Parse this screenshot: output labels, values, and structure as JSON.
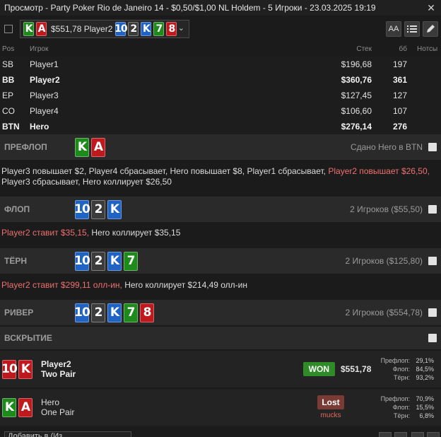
{
  "window": {
    "title": "Просмотр - Party Poker Rio de Janeiro 14 - $0,50/$1,00 NL Holdem - 5 Игроки - 23.03.2025 19:19",
    "close_glyph": "✕"
  },
  "hand_selector": {
    "hero_cards": [
      {
        "rank": "K",
        "suit": "c"
      },
      {
        "rank": "A",
        "suit": "h"
      }
    ],
    "amount": "$551,78 Player2",
    "board": [
      {
        "rank": "10",
        "suit": "d"
      },
      {
        "rank": "2",
        "suit": "s"
      },
      {
        "rank": "K",
        "suit": "d"
      },
      {
        "rank": "7",
        "suit": "c"
      },
      {
        "rank": "8",
        "suit": "h"
      }
    ],
    "caret": "⌄"
  },
  "toolbar_icons": {
    "font_size": "AA",
    "list": "list-icon",
    "edit": "pencil-icon"
  },
  "players": {
    "headers": {
      "pos": "Pos",
      "name": "Игрок",
      "stack": "Стек",
      "bb": "бб",
      "notes": "Нотсы"
    },
    "rows": [
      {
        "pos": "SB",
        "name": "Player1",
        "stack": "$196,68",
        "bb": "197",
        "bold": false
      },
      {
        "pos": "BB",
        "name": "Player2",
        "stack": "$360,76",
        "bb": "361",
        "bold": true
      },
      {
        "pos": "EP",
        "name": "Player3",
        "stack": "$127,45",
        "bb": "127",
        "bold": false
      },
      {
        "pos": "CO",
        "name": "Player4",
        "stack": "$106,60",
        "bb": "107",
        "bold": false
      },
      {
        "pos": "BTN",
        "name": "Hero",
        "stack": "$276,14",
        "bb": "276",
        "bold": true
      }
    ]
  },
  "streets": {
    "preflop": {
      "name": "ПРЕФЛОП",
      "info": "Сдано Hero в BTN",
      "cards": [
        {
          "rank": "K",
          "suit": "c"
        },
        {
          "rank": "A",
          "suit": "h"
        }
      ],
      "actions": [
        {
          "text": "Player3 повышает $2, Player4 сбрасывает, Hero повышает $8, Player1 сбрасывает, ",
          "red": false
        },
        {
          "text": "Player2 повышает $26,50,",
          "red": true
        },
        {
          "text": " Player3 сбрасывает, Hero коллирует $26,50",
          "red": false
        }
      ]
    },
    "flop": {
      "name": "ФЛОП",
      "info": "2 Игроков ($55,50)",
      "cards": [
        {
          "rank": "10",
          "suit": "d"
        },
        {
          "rank": "2",
          "suit": "s"
        },
        {
          "rank": "K",
          "suit": "d"
        }
      ],
      "actions": [
        {
          "text": "Player2 ставит $35,15,",
          "red": true
        },
        {
          "text": " Hero коллирует $35,15",
          "red": false
        }
      ]
    },
    "turn": {
      "name": "ТЁРН",
      "info": "2 Игроков ($125,80)",
      "cards": [
        {
          "rank": "10",
          "suit": "d"
        },
        {
          "rank": "2",
          "suit": "s"
        },
        {
          "rank": "K",
          "suit": "d"
        },
        {
          "rank": "7",
          "suit": "c"
        }
      ],
      "actions": [
        {
          "text": "Player2 ставит $299,11 олл-ин,",
          "red": true
        },
        {
          "text": " Hero коллирует $214,49 олл-ин",
          "red": false
        }
      ]
    },
    "river": {
      "name": "РИВЕР",
      "info": "2 Игроков ($554,78)",
      "cards": [
        {
          "rank": "10",
          "suit": "d"
        },
        {
          "rank": "2",
          "suit": "s"
        },
        {
          "rank": "K",
          "suit": "d"
        },
        {
          "rank": "7",
          "suit": "c"
        },
        {
          "rank": "8",
          "suit": "h"
        }
      ]
    },
    "showdown": {
      "name": "ВСКРЫТИЕ"
    }
  },
  "showdown": [
    {
      "player": "Player2",
      "hand": "Two Pair",
      "cards": [
        {
          "rank": "10",
          "suit": "h"
        },
        {
          "rank": "K",
          "suit": "h"
        }
      ],
      "result": "WON",
      "amount": "$551,78",
      "equity": [
        {
          "label": "Префлоп:",
          "value": "29,1%"
        },
        {
          "label": "Флоп:",
          "value": "84,5%"
        },
        {
          "label": "Тёрн:",
          "value": "93,2%"
        }
      ]
    },
    {
      "player": "Hero",
      "hand": "One Pair",
      "cards": [
        {
          "rank": "K",
          "suit": "c"
        },
        {
          "rank": "A",
          "suit": "h"
        }
      ],
      "result": "Lost",
      "sub": "mucks",
      "equity": [
        {
          "label": "Префлоп:",
          "value": "70,9%"
        },
        {
          "label": "Флоп:",
          "value": "15,5%"
        },
        {
          "label": "Тёрн:",
          "value": "6,8%"
        }
      ]
    }
  ],
  "bottom": {
    "dropdown": "Добавить в (Из..."
  },
  "colors": {
    "club": "#1f8a1c",
    "heart": "#c0191d",
    "diamond": "#1f63c4",
    "spade": "#3c3c3c",
    "won": "#2f8a28",
    "lost": "#7a3b35",
    "red_action": "#f07070"
  }
}
